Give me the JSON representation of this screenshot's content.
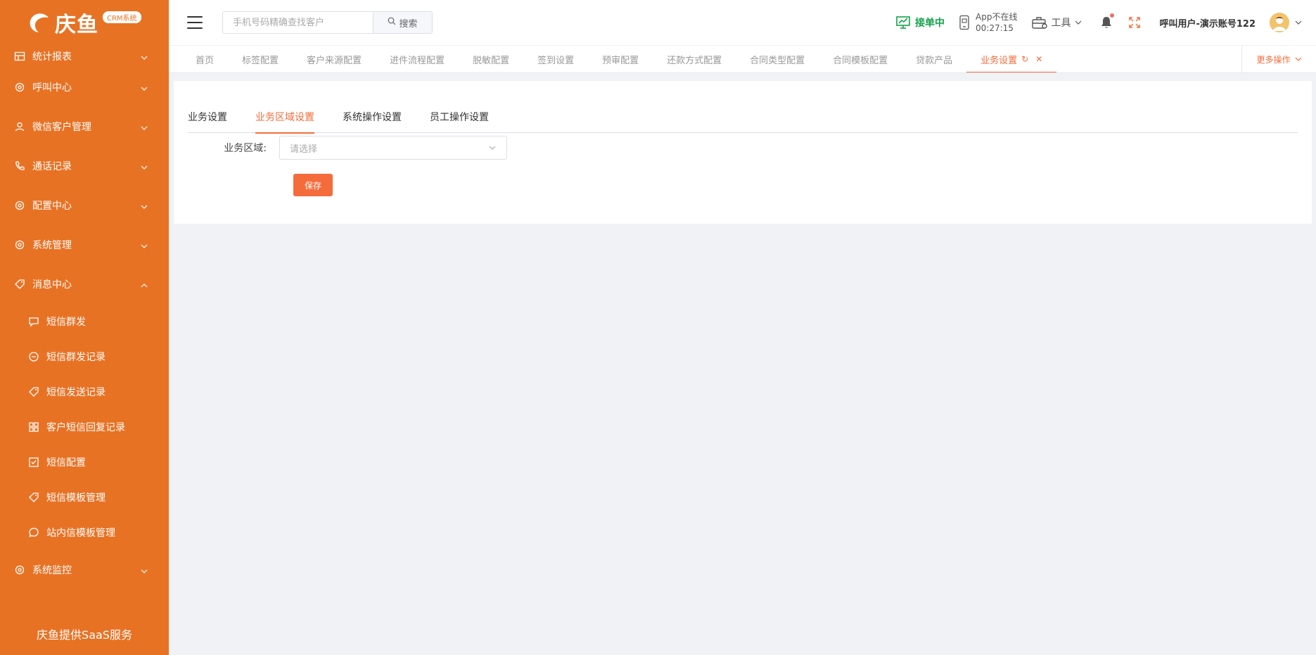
{
  "brand": {
    "name": "庆鱼",
    "badge": "CRM系统",
    "footer": "庆鱼提供SaaS服务"
  },
  "sidebar": {
    "items": [
      {
        "label": "统计报表",
        "icon": "report-icon"
      },
      {
        "label": "呼叫中心",
        "icon": "gear-icon"
      },
      {
        "label": "微信客户管理",
        "icon": "user-icon"
      },
      {
        "label": "通话记录",
        "icon": "phone-icon"
      },
      {
        "label": "配置中心",
        "icon": "gear-icon"
      },
      {
        "label": "系统管理",
        "icon": "gear-icon"
      },
      {
        "label": "消息中心",
        "icon": "tag-icon"
      }
    ],
    "subitems": [
      {
        "label": "短信群发",
        "icon": "message-icon"
      },
      {
        "label": "短信群发记录",
        "icon": "minus-circle-icon"
      },
      {
        "label": "短信发送记录",
        "icon": "tag-icon"
      },
      {
        "label": "客户短信回复记录",
        "icon": "grid-icon"
      },
      {
        "label": "短信配置",
        "icon": "checkbox-icon"
      },
      {
        "label": "短信模板管理",
        "icon": "tag-icon"
      },
      {
        "label": "站内信模板管理",
        "icon": "chat-icon"
      }
    ],
    "last_item": {
      "label": "系统监控",
      "icon": "gear-icon"
    }
  },
  "header": {
    "search_placeholder": "手机号码精确查找客户",
    "search_button": "搜索",
    "status_label": "接单中",
    "app_status": "App不在线",
    "app_time": "00:27:15",
    "tools_label": "工具",
    "user_name": "呼叫用户-演示账号122"
  },
  "tabs": [
    {
      "label": "首页"
    },
    {
      "label": "标签配置"
    },
    {
      "label": "客户来源配置"
    },
    {
      "label": "进件流程配置"
    },
    {
      "label": "脱敏配置"
    },
    {
      "label": "签到设置"
    },
    {
      "label": "预审配置"
    },
    {
      "label": "还款方式配置"
    },
    {
      "label": "合同类型配置"
    },
    {
      "label": "合同模板配置"
    },
    {
      "label": "贷款产品"
    },
    {
      "label": "业务设置"
    }
  ],
  "more_ops": "更多操作",
  "content": {
    "inner_tabs": [
      "业务设置",
      "业务区域设置",
      "系统操作设置",
      "员工操作设置"
    ],
    "form_label": "业务区域:",
    "select_placeholder": "请选择",
    "save_label": "保存"
  },
  "colors": {
    "sidebar": "#e87224",
    "accent": "#f56c3c",
    "status": "#13a34a"
  }
}
